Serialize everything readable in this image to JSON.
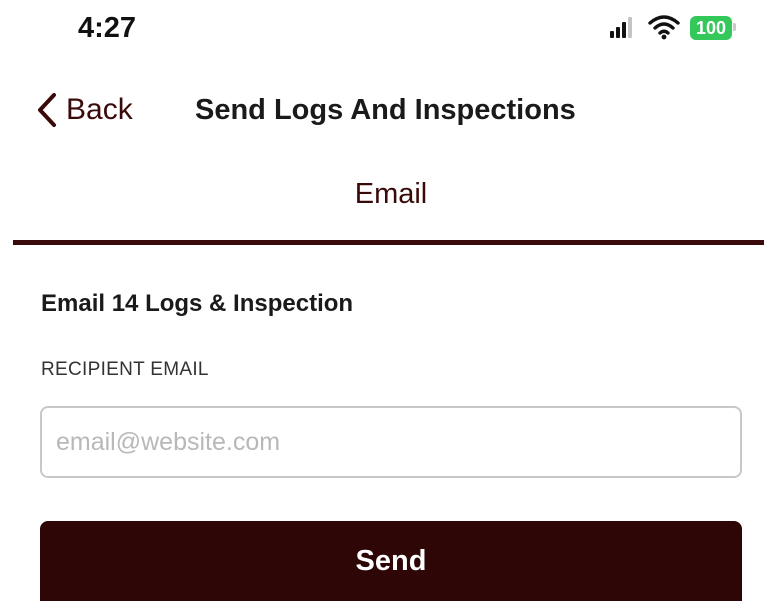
{
  "status_bar": {
    "time": "4:27",
    "battery_level": "100",
    "signal_icon": "cellular-signal-icon",
    "wifi_icon": "wifi-icon"
  },
  "nav": {
    "back_label": "Back",
    "title": "Send Logs And Inspections",
    "back_icon": "chevron-left-icon"
  },
  "tabs": [
    {
      "label": "Email",
      "selected": true
    }
  ],
  "form": {
    "heading": "Email 14 Logs & Inspection",
    "recipient_label": "RECIPIENT EMAIL",
    "email_value": "",
    "email_placeholder": "email@website.com",
    "send_label": "Send"
  },
  "colors": {
    "brand": "#2e0606",
    "accent_text": "#3a0a0a",
    "battery": "#34c759",
    "input_border": "#c8c8c8"
  }
}
